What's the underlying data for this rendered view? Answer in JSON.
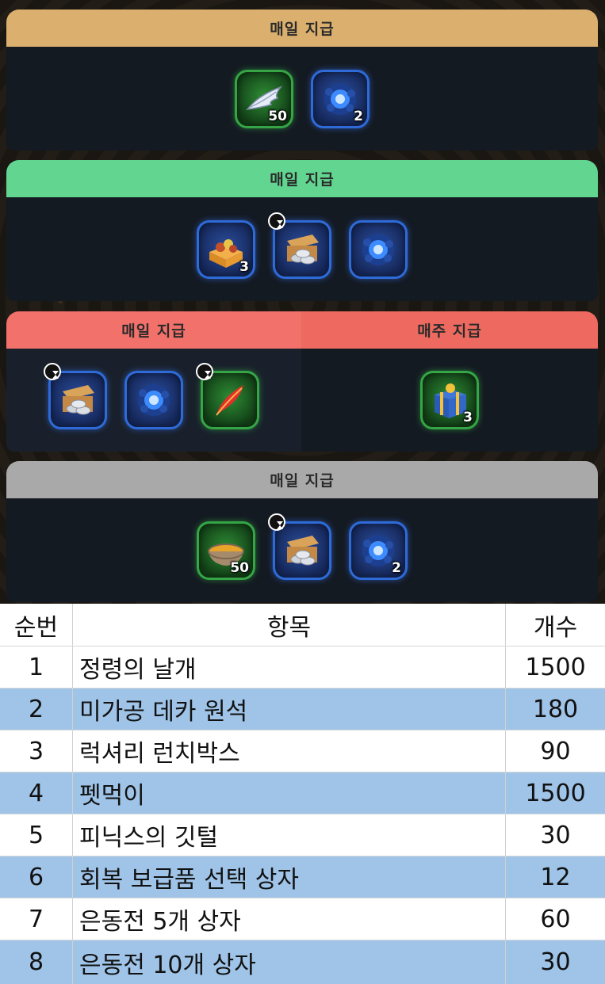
{
  "panels": [
    {
      "header": "매일 지급",
      "header_color": "#dbb06e",
      "items": [
        {
          "icon": "wing-icon",
          "frame": "green",
          "qty": "50"
        },
        {
          "icon": "blue-gem-icon",
          "frame": "blue",
          "qty": "2"
        }
      ]
    },
    {
      "header": "매일 지급",
      "header_color": "#62d690",
      "items": [
        {
          "icon": "lunch-box-icon",
          "frame": "blue",
          "qty": "3"
        },
        {
          "icon": "coin-chest-icon",
          "frame": "blue",
          "qty": "",
          "timer": true
        },
        {
          "icon": "blue-gem-icon",
          "frame": "blue",
          "qty": ""
        }
      ]
    },
    {
      "header": "매일 지급",
      "header_color": "#f2716a",
      "items": [
        {
          "icon": "coin-chest-icon",
          "frame": "blue",
          "qty": "",
          "timer": true
        },
        {
          "icon": "blue-gem-icon",
          "frame": "blue",
          "qty": ""
        },
        {
          "icon": "red-feather-icon",
          "frame": "green",
          "qty": "",
          "timer": true
        }
      ],
      "right_header": "매주 지급",
      "right_items": [
        {
          "icon": "gift-box-icon",
          "frame": "green",
          "qty": "3"
        }
      ]
    },
    {
      "header": "매일 지급",
      "header_color": "#a9a9a9",
      "items": [
        {
          "icon": "pet-food-bowl-icon",
          "frame": "green",
          "qty": "50"
        },
        {
          "icon": "coin-chest-icon",
          "frame": "blue",
          "qty": "",
          "timer": true
        },
        {
          "icon": "blue-gem-icon",
          "frame": "blue",
          "qty": "2"
        }
      ]
    }
  ],
  "table": {
    "headers": [
      "순번",
      "항목",
      "개수"
    ],
    "rows": [
      [
        "1",
        "정령의 날개",
        "1500"
      ],
      [
        "2",
        "미가공 데카 원석",
        "180"
      ],
      [
        "3",
        "럭셔리 런치박스",
        "90"
      ],
      [
        "4",
        "펫먹이",
        "1500"
      ],
      [
        "5",
        "피닉스의 깃털",
        "30"
      ],
      [
        "6",
        "회복 보급품 선택 상자",
        "12"
      ],
      [
        "7",
        "은동전 5개 상자",
        "60"
      ],
      [
        "8",
        "은동전 10개 상자",
        "30"
      ]
    ],
    "alt_row_color": "#9fc4e8"
  }
}
